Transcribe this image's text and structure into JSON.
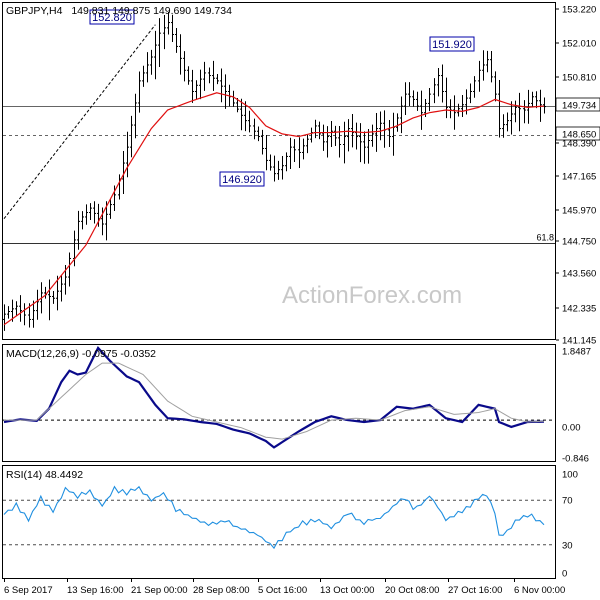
{
  "header": {
    "symbol": "GBPJPY,H4",
    "ohlc": "149.831 149.875 149.690 149.734"
  },
  "watermark": "ActionForex.com",
  "colors": {
    "candle": "#000000",
    "ma": "#e01010",
    "macd": "#0a0a8a",
    "macd_signal": "#a0a0a0",
    "rsi": "#1f8fe0",
    "grid": "#000000",
    "label_box_border": "#0000aa",
    "label_text": "#000080",
    "watermark": "#c8c8c8"
  },
  "chart_data": [
    {
      "type": "candlestick",
      "ylim": [
        141.0,
        153.6
      ],
      "y_ticks": [
        "153.220",
        "152.010",
        "150.810",
        "149.734",
        "148.650",
        "148.390",
        "147.165",
        "145.970",
        "144.750",
        "143.560",
        "142.335",
        "141.145"
      ],
      "x_ticks": [
        "6 Sep 2017",
        "13 Sep 16:00",
        "21 Sep 00:00",
        "28 Sep 08:00",
        "5 Oct 16:00",
        "13 Oct 00:00",
        "20 Oct 08:00",
        "27 Oct 16:00",
        "6 Nov 00:00"
      ],
      "annotations": [
        {
          "text": "152.820",
          "value": 152.82
        },
        {
          "text": "151.920",
          "value": 151.92
        },
        {
          "text": "146.920",
          "value": 146.92
        }
      ],
      "levels": [
        {
          "label": "149.734",
          "value": 149.734,
          "style": "solid",
          "boxed": true
        },
        {
          "label": "148.650",
          "value": 148.65,
          "style": "dashed",
          "boxed": true
        },
        {
          "label": "61.8",
          "value": 144.57,
          "style": "solid",
          "boxed": false
        }
      ],
      "trendline": {
        "from": [
          0,
          145.5
        ],
        "to": [
          37,
          152.82
        ]
      },
      "price_anchors": [
        [
          0,
          141.9
        ],
        [
          3,
          142.2
        ],
        [
          6,
          141.7
        ],
        [
          9,
          142.7
        ],
        [
          12,
          142.5
        ],
        [
          15,
          143.3
        ],
        [
          18,
          145.4
        ],
        [
          21,
          145.9
        ],
        [
          24,
          145.3
        ],
        [
          27,
          146.4
        ],
        [
          30,
          148.2
        ],
        [
          33,
          150.7
        ],
        [
          36,
          151.6
        ],
        [
          38,
          152.5
        ],
        [
          40,
          152.9
        ],
        [
          42,
          152.0
        ],
        [
          44,
          151.1
        ],
        [
          46,
          150.3
        ],
        [
          49,
          151.0
        ],
        [
          52,
          150.7
        ],
        [
          55,
          150.1
        ],
        [
          58,
          149.4
        ],
        [
          60,
          149.0
        ],
        [
          62,
          148.6
        ],
        [
          64,
          147.7
        ],
        [
          66,
          147.2
        ],
        [
          68,
          147.5
        ],
        [
          70,
          148.2
        ],
        [
          72,
          148.0
        ],
        [
          74,
          148.5
        ],
        [
          76,
          149.0
        ],
        [
          78,
          148.4
        ],
        [
          80,
          148.8
        ],
        [
          82,
          148.3
        ],
        [
          84,
          148.9
        ],
        [
          86,
          148.6
        ],
        [
          88,
          148.2
        ],
        [
          90,
          148.7
        ],
        [
          92,
          149.1
        ],
        [
          94,
          148.6
        ],
        [
          96,
          149.3
        ],
        [
          98,
          150.2
        ],
        [
          100,
          150.0
        ],
        [
          102,
          149.5
        ],
        [
          104,
          150.2
        ],
        [
          106,
          150.9
        ],
        [
          108,
          149.7
        ],
        [
          110,
          149.5
        ],
        [
          112,
          149.8
        ],
        [
          114,
          150.3
        ],
        [
          116,
          151.1
        ],
        [
          118,
          151.5
        ],
        [
          120,
          150.2
        ],
        [
          121,
          148.9
        ],
        [
          123,
          149.2
        ],
        [
          125,
          149.7
        ],
        [
          127,
          149.6
        ],
        [
          129,
          150.1
        ],
        [
          131,
          149.8
        ],
        [
          132,
          149.73
        ]
      ],
      "ma_anchors": [
        [
          0,
          141.5
        ],
        [
          10,
          142.6
        ],
        [
          20,
          144.5
        ],
        [
          30,
          147.4
        ],
        [
          36,
          148.9
        ],
        [
          40,
          149.6
        ],
        [
          46,
          149.95
        ],
        [
          52,
          150.25
        ],
        [
          56,
          150.1
        ],
        [
          60,
          149.7
        ],
        [
          64,
          149.0
        ],
        [
          68,
          148.7
        ],
        [
          72,
          148.6
        ],
        [
          76,
          148.75
        ],
        [
          80,
          148.75
        ],
        [
          84,
          148.8
        ],
        [
          88,
          148.75
        ],
        [
          92,
          148.8
        ],
        [
          96,
          149.0
        ],
        [
          100,
          149.3
        ],
        [
          104,
          149.5
        ],
        [
          108,
          149.6
        ],
        [
          112,
          149.55
        ],
        [
          116,
          149.7
        ],
        [
          120,
          150.0
        ],
        [
          124,
          149.8
        ],
        [
          128,
          149.7
        ],
        [
          132,
          149.75
        ]
      ]
    },
    {
      "type": "line",
      "title": "MACD(12,26,9) -0.0975 -0.0352",
      "ylim": [
        -1.05,
        1.95
      ],
      "y_ticks": [
        "1.8487",
        "0.00",
        "-0.846"
      ],
      "zero_line": true,
      "series": [
        {
          "role": "macd",
          "anchors": [
            [
              0,
              -0.05
            ],
            [
              4,
              0.02
            ],
            [
              8,
              -0.02
            ],
            [
              11,
              0.3
            ],
            [
              14,
              1.0
            ],
            [
              16,
              1.3
            ],
            [
              18,
              1.2
            ],
            [
              20,
              1.25
            ],
            [
              23,
              1.9
            ],
            [
              26,
              1.55
            ],
            [
              30,
              1.15
            ],
            [
              33,
              1.0
            ],
            [
              37,
              0.4
            ],
            [
              40,
              0.05
            ],
            [
              44,
              0.02
            ],
            [
              48,
              -0.05
            ],
            [
              52,
              -0.1
            ],
            [
              56,
              -0.25
            ],
            [
              60,
              -0.35
            ],
            [
              64,
              -0.55
            ],
            [
              66,
              -0.72
            ],
            [
              68,
              -0.58
            ],
            [
              72,
              -0.3
            ],
            [
              76,
              -0.05
            ],
            [
              80,
              0.1
            ],
            [
              84,
              0.0
            ],
            [
              88,
              -0.05
            ],
            [
              92,
              0.0
            ],
            [
              96,
              0.35
            ],
            [
              100,
              0.3
            ],
            [
              104,
              0.4
            ],
            [
              108,
              0.05
            ],
            [
              112,
              -0.05
            ],
            [
              116,
              0.4
            ],
            [
              120,
              0.3
            ],
            [
              121,
              -0.05
            ],
            [
              124,
              -0.18
            ],
            [
              128,
              -0.05
            ],
            [
              132,
              -0.04
            ]
          ]
        },
        {
          "role": "signal",
          "anchors": [
            [
              0,
              0.0
            ],
            [
              8,
              0.0
            ],
            [
              14,
              0.6
            ],
            [
              20,
              1.2
            ],
            [
              24,
              1.5
            ],
            [
              28,
              1.5
            ],
            [
              34,
              1.2
            ],
            [
              40,
              0.5
            ],
            [
              46,
              0.1
            ],
            [
              52,
              -0.05
            ],
            [
              58,
              -0.2
            ],
            [
              64,
              -0.45
            ],
            [
              68,
              -0.5
            ],
            [
              74,
              -0.3
            ],
            [
              80,
              0.0
            ],
            [
              86,
              0.05
            ],
            [
              92,
              0.0
            ],
            [
              98,
              0.25
            ],
            [
              104,
              0.35
            ],
            [
              110,
              0.15
            ],
            [
              116,
              0.2
            ],
            [
              120,
              0.3
            ],
            [
              124,
              0.05
            ],
            [
              128,
              -0.05
            ],
            [
              132,
              -0.03
            ]
          ]
        }
      ]
    },
    {
      "type": "line",
      "title": "RSI(14) 48.4492",
      "ylim": [
        0,
        100
      ],
      "y_ticks": [
        "100",
        "70",
        "30",
        "0"
      ],
      "levels": [
        70,
        30
      ],
      "series": [
        {
          "role": "rsi",
          "anchors": [
            [
              0,
              58
            ],
            [
              3,
              66
            ],
            [
              6,
              52
            ],
            [
              9,
              72
            ],
            [
              12,
              60
            ],
            [
              15,
              80
            ],
            [
              18,
              74
            ],
            [
              21,
              78
            ],
            [
              24,
              65
            ],
            [
              27,
              80
            ],
            [
              30,
              76
            ],
            [
              33,
              82
            ],
            [
              36,
              70
            ],
            [
              39,
              76
            ],
            [
              42,
              62
            ],
            [
              46,
              55
            ],
            [
              50,
              48
            ],
            [
              54,
              52
            ],
            [
              58,
              44
            ],
            [
              62,
              40
            ],
            [
              64,
              33
            ],
            [
              66,
              28
            ],
            [
              68,
              36
            ],
            [
              72,
              48
            ],
            [
              76,
              52
            ],
            [
              80,
              46
            ],
            [
              84,
              58
            ],
            [
              88,
              50
            ],
            [
              92,
              54
            ],
            [
              94,
              60
            ],
            [
              96,
              68
            ],
            [
              98,
              72
            ],
            [
              100,
              62
            ],
            [
              102,
              66
            ],
            [
              104,
              74
            ],
            [
              106,
              64
            ],
            [
              108,
              52
            ],
            [
              110,
              56
            ],
            [
              112,
              60
            ],
            [
              114,
              66
            ],
            [
              116,
              72
            ],
            [
              118,
              75
            ],
            [
              120,
              60
            ],
            [
              121,
              38
            ],
            [
              123,
              42
            ],
            [
              125,
              50
            ],
            [
              127,
              55
            ],
            [
              129,
              57
            ],
            [
              131,
              50
            ],
            [
              132,
              48.45
            ]
          ]
        }
      ]
    }
  ]
}
